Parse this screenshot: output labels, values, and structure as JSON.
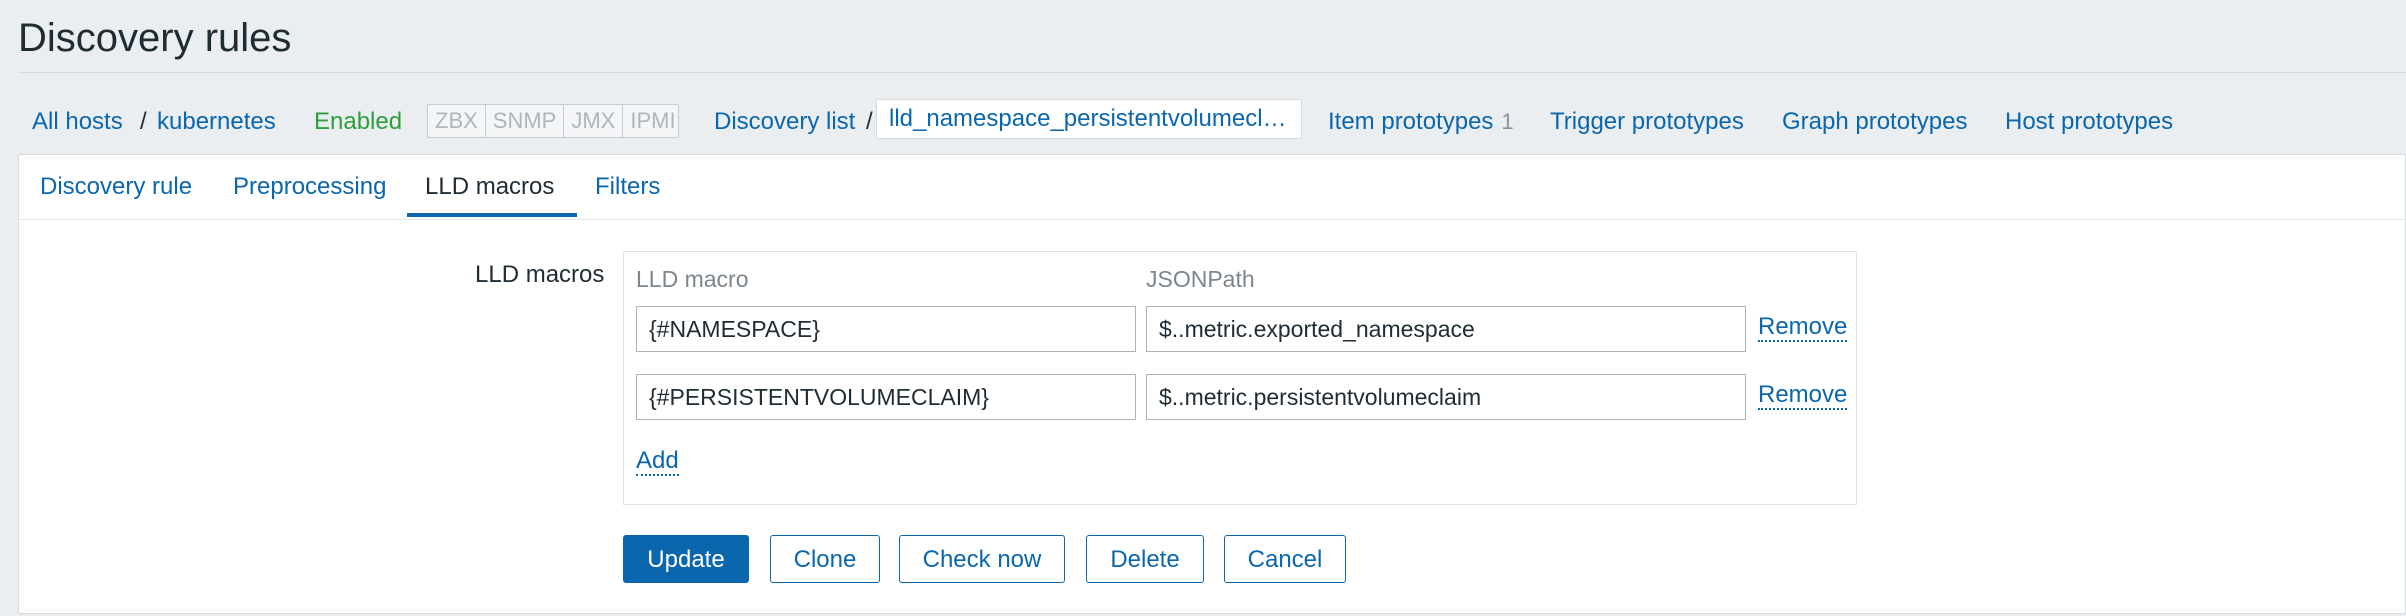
{
  "page": {
    "title": "Discovery rules"
  },
  "breadcrumbs": {
    "all_hosts": "All hosts",
    "separator": "/",
    "host": "kubernetes",
    "status": "Enabled",
    "interfaces": [
      "ZBX",
      "SNMP",
      "JMX",
      "IPMI"
    ],
    "discovery_list": "Discovery list",
    "current_rule": "lld_namespace_persistentvolumecl…",
    "item_prototypes": "Item prototypes",
    "item_prototypes_count": "1",
    "trigger_prototypes": "Trigger prototypes",
    "graph_prototypes": "Graph prototypes",
    "host_prototypes": "Host prototypes"
  },
  "tabs": [
    {
      "label": "Discovery rule",
      "active": false
    },
    {
      "label": "Preprocessing",
      "active": false
    },
    {
      "label": "LLD macros",
      "active": true
    },
    {
      "label": "Filters",
      "active": false
    }
  ],
  "form": {
    "label": "LLD macros",
    "columns": {
      "macro": "LLD macro",
      "path": "JSONPath"
    },
    "rows": [
      {
        "macro": "{#NAMESPACE}",
        "path": "$..metric.exported_namespace",
        "remove": "Remove"
      },
      {
        "macro": "{#PERSISTENTVOLUMECLAIM}",
        "path": "$..metric.persistentvolumeclaim",
        "remove": "Remove"
      }
    ],
    "add": "Add"
  },
  "buttons": {
    "update": "Update",
    "clone": "Clone",
    "check_now": "Check now",
    "delete": "Delete",
    "cancel": "Cancel"
  },
  "colors": {
    "link": "#0a67ad",
    "enabled": "#2f9d3e",
    "background": "#ebeef0"
  }
}
